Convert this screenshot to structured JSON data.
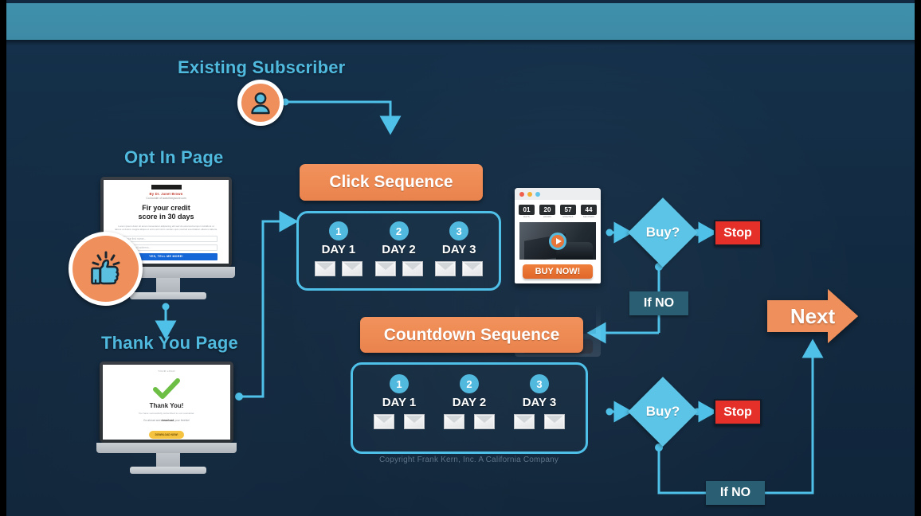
{
  "theme": {
    "background": "#12293f",
    "topbar": "#3f91ac",
    "accent_blue": "#4fc0e8",
    "heading_blue": "#4fb9de",
    "accent_orange": "#ef8f5b",
    "stop_red": "#e5302a",
    "ifno_teal": "#2a5e72"
  },
  "headings": {
    "existing_subscriber": "Existing Subscriber",
    "opt_in_page": "Opt In Page",
    "thank_you_page": "Thank You Page"
  },
  "banners": {
    "click_sequence": "Click Sequence",
    "countdown_sequence": "Countdown Sequence"
  },
  "click_sequence": {
    "days": [
      {
        "number": "1",
        "label": "DAY 1",
        "emails": 2
      },
      {
        "number": "2",
        "label": "DAY 2",
        "emails": 2
      },
      {
        "number": "3",
        "label": "DAY 3",
        "emails": 2
      }
    ]
  },
  "countdown_sequence": {
    "days": [
      {
        "number": "1",
        "label": "DAY 1",
        "emails": 2
      },
      {
        "number": "2",
        "label": "DAY 2",
        "emails": 2
      },
      {
        "number": "3",
        "label": "DAY 3",
        "emails": 2
      }
    ]
  },
  "decisions": {
    "buy_top": "Buy?",
    "buy_bottom": "Buy?",
    "stop_top": "Stop",
    "stop_bottom": "Stop",
    "if_no_top": "If NO",
    "if_no_bottom": "If NO"
  },
  "next_arrow": {
    "label": "Next"
  },
  "sales_page": {
    "timer": [
      {
        "value": "01",
        "label": "DAYS"
      },
      {
        "value": "20",
        "label": "HOURS"
      },
      {
        "value": "57",
        "label": "MINUTES"
      },
      {
        "value": "44",
        "label": "SECONDS"
      }
    ],
    "cta": "BUY NOW!",
    "dots": [
      "#ef5f4c",
      "#f2b134",
      "#62c4e8"
    ]
  },
  "opt_in_screen": {
    "logo": "FREE MASTER CLASS",
    "byline": "By Dr. Janet Brown",
    "byline2": "Co-founder of www.fixmyscore.com",
    "headline_line1": "Fir your credit",
    "headline_line2": "score in 30 days",
    "paragraph": "Lorem ipsum dolor sit amet consectetur adipiscing elit sed do eiusmod tempor incididunt ut labore et dolore magna aliqua ut enim ad minim veniam quis nostrud exercitation ullamco laboris.",
    "field_first_name": "Enter your first name...",
    "field_email": "Enter your email address...",
    "cta": "YES, TELL ME MORE!"
  },
  "thank_you_screen": {
    "logo": "YOUR LOGO",
    "headline": "Thank You!",
    "sub": "You have successfully subscribed to our newsletter.",
    "download_pre": "Go ahead and",
    "download_bold": "download",
    "download_post": "your freebie!",
    "button": "DOWNLOAD NOW!"
  },
  "icons": {
    "subscriber": "user-avatar-icon",
    "thumbs_up": "thumbs-up-icon",
    "play": "play-icon",
    "check": "check-icon"
  },
  "footer": {
    "copyright": "Copyright Frank Kern, Inc. A California Company"
  }
}
